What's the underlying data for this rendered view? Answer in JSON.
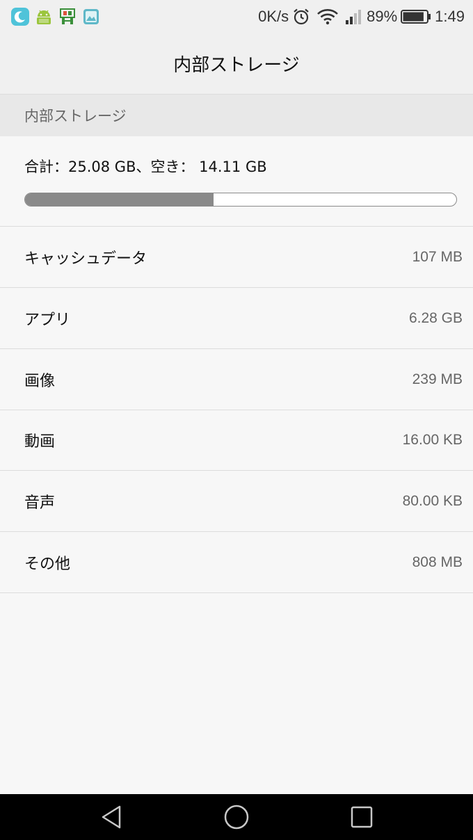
{
  "status_bar": {
    "notification_icons": [
      "moon-app-icon",
      "android-mix-icon",
      "translate-app-icon",
      "gallery-app-icon"
    ],
    "network_speed": "0K/s",
    "battery_percent": "89%",
    "battery_level": 0.89,
    "time": "1:49"
  },
  "header": {
    "title": "内部ストレージ"
  },
  "section": {
    "label": "内部ストレージ"
  },
  "summary": {
    "text": "合計：25.08 GB、空き： 14.11 GB",
    "used_fraction": 0.437
  },
  "items": [
    {
      "label": "キャッシュデータ",
      "value": "107 MB"
    },
    {
      "label": "アプリ",
      "value": "6.28 GB"
    },
    {
      "label": "画像",
      "value": "239 MB"
    },
    {
      "label": "動画",
      "value": "16.00 KB"
    },
    {
      "label": "音声",
      "value": "80.00 KB"
    },
    {
      "label": "その他",
      "value": "808 MB"
    }
  ],
  "colors": {
    "progress_fill": "#8a8a8a",
    "status_bar_bg": "#f0f0f0",
    "nav_bar_bg": "#000000"
  }
}
